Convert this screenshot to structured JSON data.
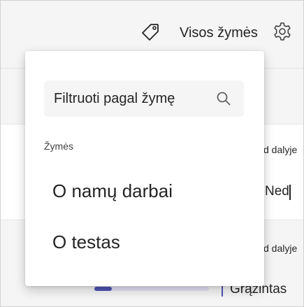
{
  "header": {
    "all_tags_label": "Visos žymės",
    "tag_icon": "tag-icon",
    "settings_icon": "gear-icon"
  },
  "dropdown": {
    "filter_placeholder": "Filtruoti pagal žymę",
    "section_label": "Žymės",
    "items": [
      {
        "label": "O namų darbai"
      },
      {
        "label": "O testas"
      }
    ]
  },
  "background": {
    "row1_part": "d dalyje",
    "row1_status": "Ned",
    "row2_part": "d dalyje",
    "row2_status": "Grąžintas",
    "progress": 0.15
  },
  "colors": {
    "accent": "#4f52b2",
    "text": "#242424",
    "panel_bg": "#ffffff",
    "page_bg": "#f5f5f5"
  }
}
